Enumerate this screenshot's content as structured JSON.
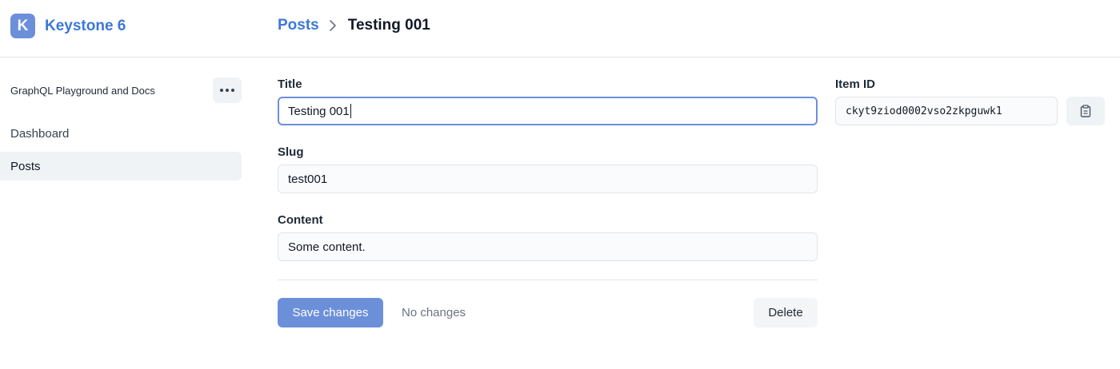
{
  "app": {
    "name": "Keystone 6",
    "logo_letter": "K",
    "brand_color": "#3c78d8",
    "accent_color": "#6c8fd9"
  },
  "breadcrumb": {
    "parent": "Posts",
    "separator_icon": "chevron-right-icon",
    "current": "Testing 001"
  },
  "sidebar": {
    "playground_label": "GraphQL Playground and Docs",
    "more_icon": "ellipsis-icon",
    "items": [
      {
        "label": "Dashboard",
        "active": false
      },
      {
        "label": "Posts",
        "active": true
      }
    ]
  },
  "form": {
    "fields": [
      {
        "label": "Title",
        "value": "Testing 001",
        "focused": true
      },
      {
        "label": "Slug",
        "value": "test001",
        "focused": false
      },
      {
        "label": "Content",
        "value": "Some content.",
        "focused": false
      }
    ],
    "save_label": "Save changes",
    "status_text": "No changes",
    "delete_label": "Delete"
  },
  "item_id": {
    "label": "Item ID",
    "value": "ckyt9ziod0002vso2zkpguwk1",
    "copy_icon": "clipboard-icon"
  }
}
